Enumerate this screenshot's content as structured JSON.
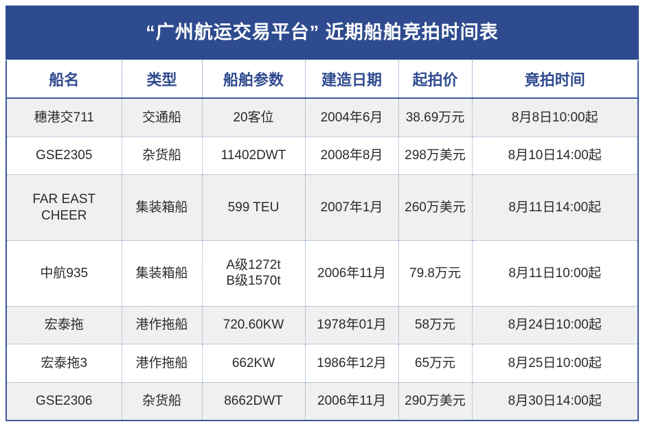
{
  "banner": {
    "title": "“广州航运交易平台” 近期船舶竞拍时间表",
    "background_color": "#2f4b8f",
    "text_color": "#ffffff"
  },
  "table": {
    "border_color": "#3a5ba0",
    "header_text_color": "#2f4b8f",
    "alt_row_color": "#f0f0f0",
    "plain_row_color": "#ffffff",
    "columns": [
      {
        "key": "ship_name",
        "label": "船名"
      },
      {
        "key": "type",
        "label": "类型"
      },
      {
        "key": "parameters",
        "label": "船舶参数"
      },
      {
        "key": "build_date",
        "label": "建造日期"
      },
      {
        "key": "start_price",
        "label": "起拍价"
      },
      {
        "key": "auction_time",
        "label": "竟拍时间"
      }
    ],
    "rows": [
      {
        "ship_name_line1": "穗港交711",
        "ship_name_line2": "",
        "type": "交通船",
        "parameters_line1": "20客位",
        "parameters_line2": "",
        "build_date": "2004年6月",
        "start_price": "38.69万元",
        "auction_time": "8月8日10:00起"
      },
      {
        "ship_name_line1": "GSE2305",
        "ship_name_line2": "",
        "type": "杂货船",
        "parameters_line1": "11402DWT",
        "parameters_line2": "",
        "build_date": "2008年8月",
        "start_price": "298万美元",
        "auction_time": "8月10日14:00起"
      },
      {
        "ship_name_line1": "FAR EAST",
        "ship_name_line2": "CHEER",
        "type": "集装箱船",
        "parameters_line1": "599 TEU",
        "parameters_line2": "",
        "build_date": "2007年1月",
        "start_price": "260万美元",
        "auction_time": "8月11日14:00起"
      },
      {
        "ship_name_line1": "中航935",
        "ship_name_line2": "",
        "type": "集装箱船",
        "parameters_line1": "A级1272t",
        "parameters_line2": "B级1570t",
        "build_date": "2006年11月",
        "start_price": "79.8万元",
        "auction_time": "8月11日10:00起"
      },
      {
        "ship_name_line1": "宏泰拖",
        "ship_name_line2": "",
        "type": "港作拖船",
        "parameters_line1": "720.60KW",
        "parameters_line2": "",
        "build_date": "1978年01月",
        "start_price": "58万元",
        "auction_time": "8月24日10:00起"
      },
      {
        "ship_name_line1": "宏泰拖3",
        "ship_name_line2": "",
        "type": "港作拖船",
        "parameters_line1": "662KW",
        "parameters_line2": "",
        "build_date": "1986年12月",
        "start_price": "65万元",
        "auction_time": "8月25日10:00起"
      },
      {
        "ship_name_line1": "GSE2306",
        "ship_name_line2": "",
        "type": "杂货船",
        "parameters_line1": "8662DWT",
        "parameters_line2": "",
        "build_date": "2006年11月",
        "start_price": "290万美元",
        "auction_time": "8月30日14:00起"
      }
    ]
  }
}
